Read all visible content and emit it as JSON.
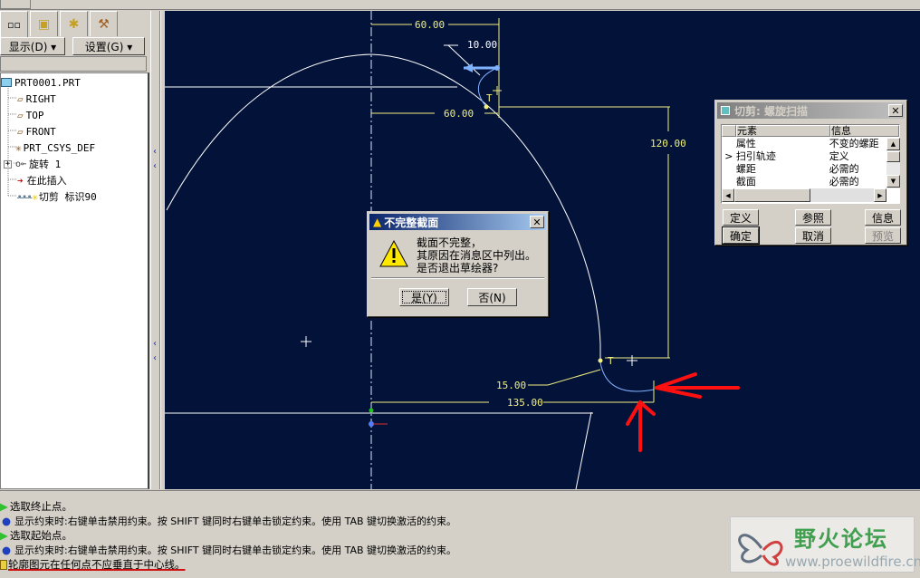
{
  "tabs": [
    {
      "icon": "model-tree-icon"
    },
    {
      "icon": "layers-icon"
    },
    {
      "icon": "folder-star-icon"
    },
    {
      "icon": "tools-icon"
    }
  ],
  "panel": {
    "show_label": "显示(D) ▾",
    "settings_label": "设置(G) ▾"
  },
  "tree": [
    {
      "label": "PRT0001.PRT",
      "icon": "part-icon"
    },
    {
      "label": "RIGHT",
      "icon": "datum-plane-icon"
    },
    {
      "label": "TOP",
      "icon": "datum-plane-icon"
    },
    {
      "label": "FRONT",
      "icon": "datum-plane-icon"
    },
    {
      "label": "PRT_CSYS_DEF",
      "icon": "csys-icon"
    },
    {
      "label": "旋转 1",
      "icon": "revolve-icon"
    },
    {
      "label": "在此插入",
      "icon": "insert-arrow-icon"
    },
    {
      "label": "切剪 标识90",
      "icon": "helical-cut-icon"
    }
  ],
  "sketch": {
    "dims": [
      "60.00",
      "10.00",
      "60.00",
      "120.00",
      "15.00",
      "135.00"
    ],
    "marks": [
      "T",
      "T"
    ]
  },
  "alert": {
    "title": "不完整截面",
    "lines": [
      "截面不完整，",
      "其原因在消息区中列出。",
      "是否退出草绘器?"
    ],
    "yes": "是(Y)",
    "no": "否(N)"
  },
  "feature_dialog": {
    "title": "切剪: 螺旋扫描",
    "col_element": "元素",
    "col_info": "信息",
    "rows": [
      {
        "element": "属性",
        "info": "不变的螺距",
        "current": false
      },
      {
        "element": "扫引轨迹",
        "info": "定义",
        "current": true
      },
      {
        "element": "螺距",
        "info": "必需的",
        "current": false
      },
      {
        "element": "截面",
        "info": "必需的",
        "current": false
      }
    ],
    "current_marker": ">",
    "buttons": {
      "define": "定义",
      "refs": "参照",
      "info": "信息",
      "ok": "确定",
      "cancel": "取消",
      "preview": "预览"
    }
  },
  "messages": [
    {
      "type": "prompt",
      "text": "选取终止点。"
    },
    {
      "type": "info",
      "text": "显示约束时:右键单击禁用约束。按 SHIFT 键同时右键单击锁定约束。使用 TAB 键切换激活的约束。"
    },
    {
      "type": "prompt",
      "text": "选取起始点。"
    },
    {
      "type": "info",
      "text": "显示约束时:右键单击禁用约束。按 SHIFT 键同时右键单击锁定约束。使用 TAB 键切换激活的约束。"
    },
    {
      "type": "warning",
      "text": "轮廓图元在任何点不应垂直于中心线。"
    }
  ],
  "watermark": {
    "name": "野火论坛",
    "url": "www.proewildfire.cn"
  },
  "colors": {
    "canvas": "#031238",
    "dim": "#f0f080",
    "geom": "#ffffff",
    "selected": "#7fb2ff",
    "annot": "#ff1010"
  }
}
